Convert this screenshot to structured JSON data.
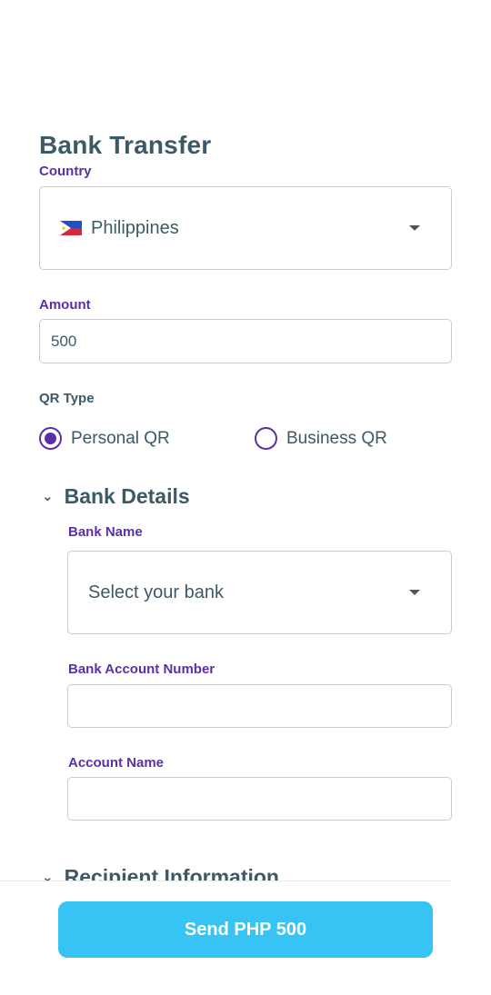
{
  "page": {
    "title": "Bank Transfer"
  },
  "country": {
    "label": "Country",
    "selected": "Philippines",
    "flag_icon": "philippines-flag"
  },
  "amount": {
    "label": "Amount",
    "value": "500"
  },
  "qr_type": {
    "label": "QR Type",
    "options": [
      {
        "label": "Personal QR",
        "selected": true
      },
      {
        "label": "Business QR",
        "selected": false
      }
    ]
  },
  "bank_details": {
    "title": "Bank Details",
    "bank_name": {
      "label": "Bank Name",
      "placeholder": "Select your bank"
    },
    "account_number": {
      "label": "Bank Account Number",
      "value": ""
    },
    "account_name": {
      "label": "Account Name",
      "value": ""
    }
  },
  "recipient": {
    "title": "Recipient Information"
  },
  "send_button": {
    "label": "Send PHP 500"
  },
  "colors": {
    "accent_purple": "#5b2fa8",
    "text_dark": "#3c5a66",
    "button_blue": "#38c3f5"
  }
}
